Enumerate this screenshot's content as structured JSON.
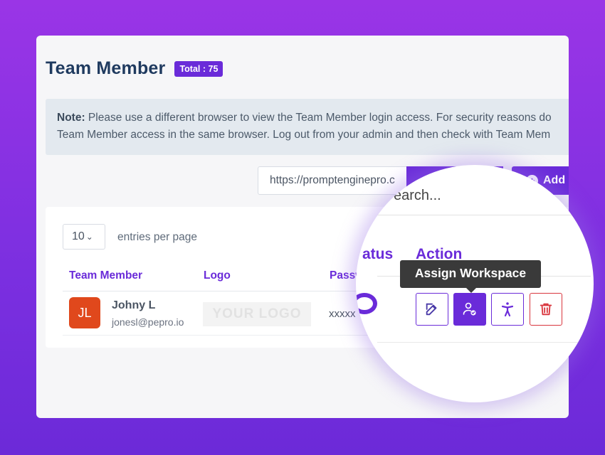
{
  "header": {
    "title": "Team Member",
    "total_badge": "Total : 75"
  },
  "note": {
    "label": "Note:",
    "line1": "Please use a different browser to view the Team Member login access. For security reasons do",
    "line2": "Team Member access in the same browser. Log out from your admin and then check with Team Mem"
  },
  "toolbar": {
    "url_value": "https://promptenginepro.c",
    "add_label": "Add"
  },
  "table": {
    "entries_value": "10",
    "entries_label": "entries per page",
    "columns": [
      "Team Member",
      "Logo",
      "Passw"
    ],
    "rows": [
      {
        "initials": "JL",
        "name": "Johny L",
        "email": "jonesl@pepro.io",
        "logo_text": "YOUR LOGO",
        "password": "xxxxx"
      }
    ]
  },
  "magnifier": {
    "search_placeholder": "earch...",
    "status_header": "atus",
    "action_header": "Action",
    "tooltip": "Assign Workspace",
    "actions": [
      "edit-icon",
      "assign-workspace-icon",
      "accessibility-icon",
      "trash-icon"
    ]
  },
  "colors": {
    "accent": "#6a2bd9",
    "danger": "#d9363e",
    "avatar": "#e0481c",
    "title": "#1f3a5f"
  }
}
